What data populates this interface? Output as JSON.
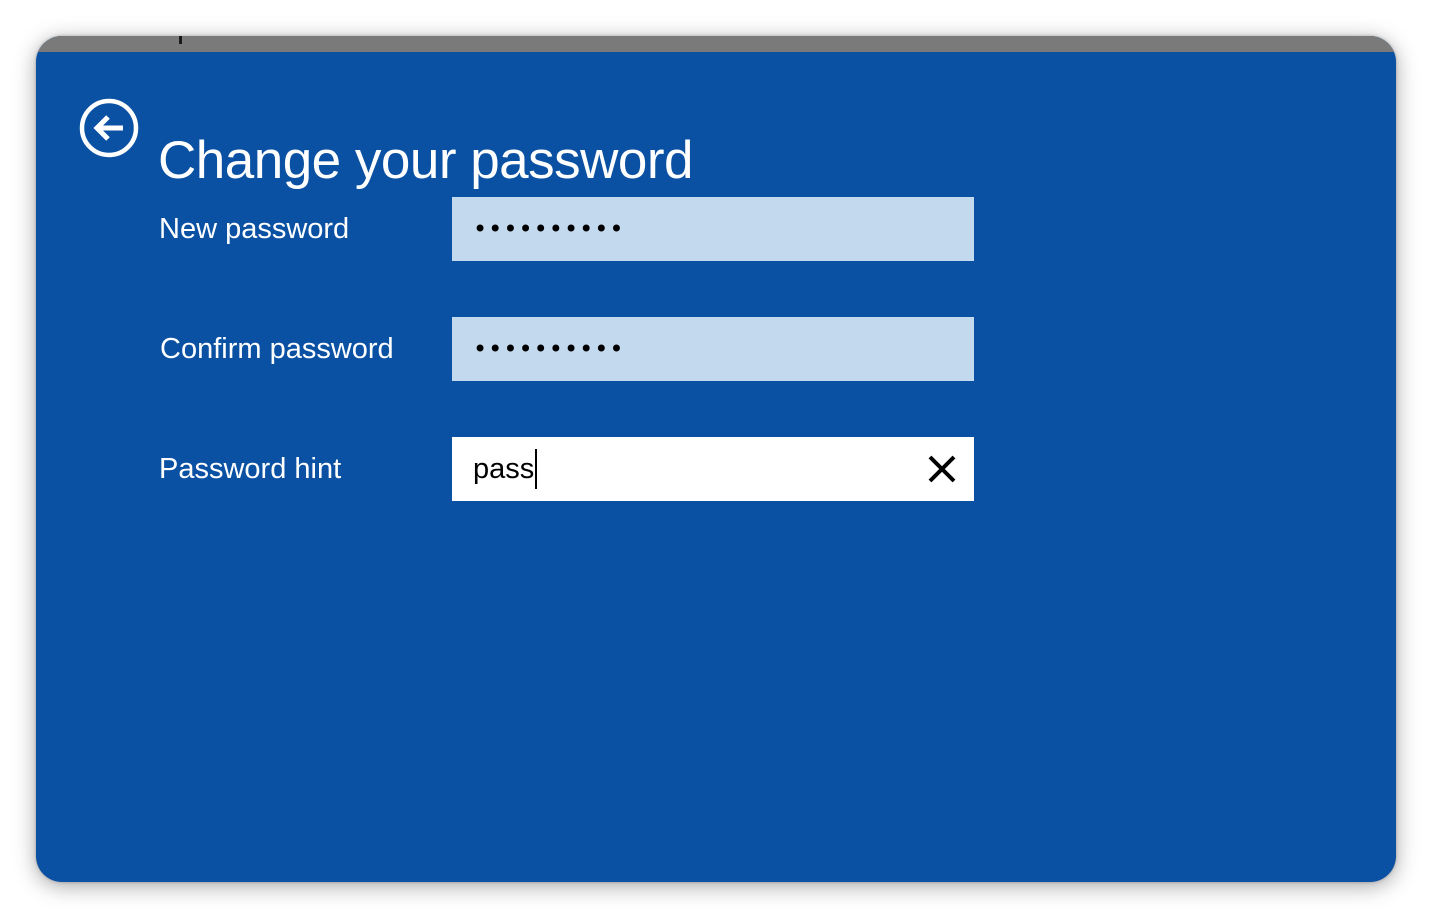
{
  "page": {
    "title": "Change your password"
  },
  "icons": {
    "back": "back-arrow-circle-icon",
    "clear": "close-icon"
  },
  "colors": {
    "background": "#0a51a3",
    "password_field": "#c3d9ed",
    "text_field": "#ffffff",
    "text": "#ffffff"
  },
  "fields": {
    "new_password": {
      "label": "New password",
      "value": "••••••••••"
    },
    "confirm_password": {
      "label": "Confirm password",
      "value": "••••••••••"
    },
    "password_hint": {
      "label": "Password hint",
      "value": "pass"
    }
  }
}
